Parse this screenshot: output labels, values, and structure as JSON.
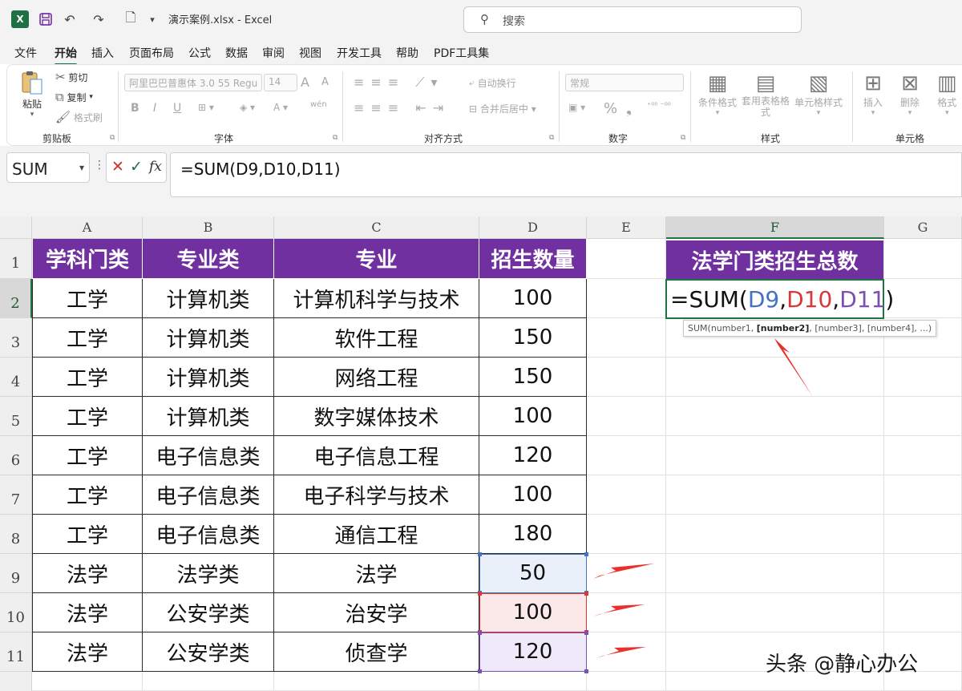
{
  "titlebar": {
    "logo": "X",
    "file_title": "演示案例.xlsx  -  Excel",
    "search_placeholder": "搜索"
  },
  "menu": {
    "tabs": [
      "文件",
      "开始",
      "插入",
      "页面布局",
      "公式",
      "数据",
      "审阅",
      "视图",
      "开发工具",
      "帮助",
      "PDF工具集"
    ],
    "active": "开始"
  },
  "ribbon": {
    "clipboard": {
      "paste": "粘贴",
      "cut": "剪切",
      "copy": "复制",
      "format_painter": "格式刷",
      "label": "剪贴板"
    },
    "font": {
      "font_name": "阿里巴巴普惠体 3.0 55 Regu",
      "font_size": "14",
      "grow": "A",
      "shrink": "A",
      "bold": "B",
      "italic": "I",
      "underline": "U",
      "phonetic": "wén",
      "label": "字体"
    },
    "alignment": {
      "wrap": "自动换行",
      "merge": "合并后居中",
      "label": "对齐方式"
    },
    "number": {
      "format": "常规",
      "percent": "%",
      "comma": "❟",
      "label": "数字"
    },
    "styles": {
      "conditional": "条件格式",
      "table": "套用表格格式",
      "cell_styles": "单元格样式",
      "label": "样式"
    },
    "cells": {
      "insert": "插入",
      "delete": "删除",
      "format": "格式",
      "label": "单元格"
    }
  },
  "formula_bar": {
    "name_box": "SUM",
    "fx": "fx",
    "formula": "=SUM(D9,D10,D11)"
  },
  "sheet": {
    "columns": [
      "A",
      "B",
      "C",
      "D",
      "E",
      "F",
      "G"
    ],
    "rows": [
      "1",
      "2",
      "3",
      "4",
      "5",
      "6",
      "7",
      "8",
      "9",
      "10",
      "11"
    ],
    "headers": [
      "学科门类",
      "专业类",
      "专业",
      "招生数量"
    ],
    "data": [
      [
        "工学",
        "计算机类",
        "计算机科学与技术",
        "100"
      ],
      [
        "工学",
        "计算机类",
        "软件工程",
        "150"
      ],
      [
        "工学",
        "计算机类",
        "网络工程",
        "150"
      ],
      [
        "工学",
        "计算机类",
        "数字媒体技术",
        "100"
      ],
      [
        "工学",
        "电子信息类",
        "电子信息工程",
        "120"
      ],
      [
        "工学",
        "电子信息类",
        "电子科学与技术",
        "100"
      ],
      [
        "工学",
        "电子信息类",
        "通信工程",
        "180"
      ],
      [
        "法学",
        "法学类",
        "法学",
        "50"
      ],
      [
        "法学",
        "公安学类",
        "治安学",
        "100"
      ],
      [
        "法学",
        "公安学类",
        "侦查学",
        "120"
      ]
    ],
    "f1": "法学门类招生总数",
    "f2_parts": [
      "=SUM(",
      "D9",
      ",",
      "D10",
      ",",
      "D11",
      ")"
    ],
    "tooltip": {
      "prefix": "SUM(number1, ",
      "bold": "[number2]",
      "suffix": ", [number3], [number4], ...)"
    },
    "ref_colors": {
      "d9": "#4472c4",
      "d10": "#d83838",
      "d11": "#7b4fb5"
    },
    "header_fill": "#7030a0",
    "arrow_color": "#e8312c"
  },
  "watermark": "头条 @静心办公"
}
